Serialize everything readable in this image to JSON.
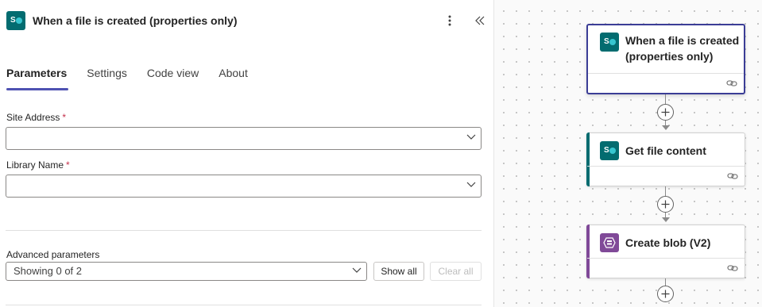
{
  "panel": {
    "title": "When a file is created (properties only)",
    "icon": "sharepoint-icon",
    "more_icon": "more-vertical-icon",
    "collapse_icon": "double-chevron-left-icon",
    "tabs": [
      {
        "label": "Parameters",
        "active": true
      },
      {
        "label": "Settings",
        "active": false
      },
      {
        "label": "Code view",
        "active": false
      },
      {
        "label": "About",
        "active": false
      }
    ],
    "fields": {
      "site_address": {
        "label": "Site Address",
        "required_mark": "*",
        "value": ""
      },
      "library_name": {
        "label": "Library Name",
        "required_mark": "*",
        "value": ""
      }
    },
    "advanced": {
      "label": "Advanced parameters",
      "selected": "Showing 0 of 2",
      "show_all": "Show all",
      "clear_all": "Clear all"
    }
  },
  "canvas": {
    "cards": [
      {
        "title_line1": "When a file is created",
        "title_line2": "(properties only)",
        "icon": "sharepoint-icon",
        "selected": true,
        "bar_color": ""
      },
      {
        "title": "Get file content",
        "icon": "sharepoint-icon",
        "selected": false,
        "bar_color": "#036c70"
      },
      {
        "title": "Create blob (V2)",
        "icon": "azure-blob-icon",
        "selected": false,
        "bar_color": "#804998"
      }
    ]
  },
  "colors": {
    "accent": "#4f52b2",
    "selected_border": "#3b3d96",
    "sharepoint": "#036c70",
    "blob": "#804998",
    "required": "#c4314b"
  }
}
